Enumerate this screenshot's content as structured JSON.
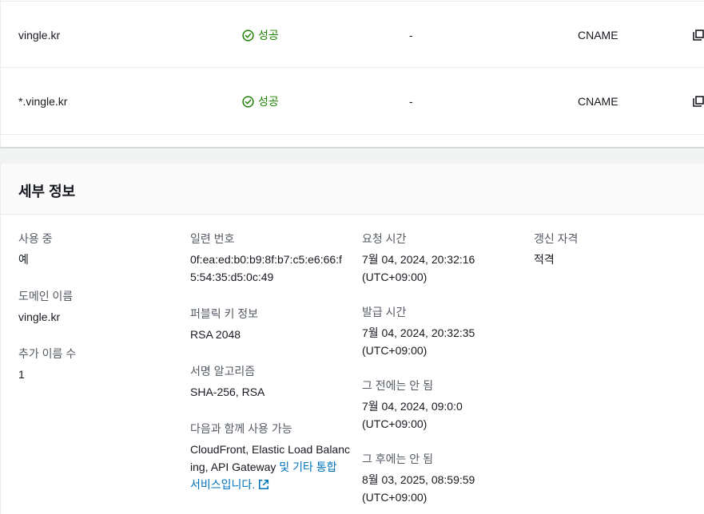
{
  "domains": [
    {
      "name": "vingle.kr",
      "status": "성공",
      "dash": "-",
      "type": "CNAME"
    },
    {
      "name": "*.vingle.kr",
      "status": "성공",
      "dash": "-",
      "type": "CNAME"
    }
  ],
  "details": {
    "title": "세부 정보",
    "in_use": {
      "label": "사용 중",
      "value": "예"
    },
    "domain_name": {
      "label": "도메인 이름",
      "value": "vingle.kr"
    },
    "additional_names": {
      "label": "추가 이름 수",
      "value": "1"
    },
    "serial": {
      "label": "일련 번호",
      "value": "0f:ea:ed:b0:b9:8f:b7:c5:e6:66:f5:54:35:d5:0c:49"
    },
    "public_key": {
      "label": "퍼블릭 키 정보",
      "value": "RSA 2048"
    },
    "signature": {
      "label": "서명 알고리즘",
      "value": "SHA-256, RSA"
    },
    "usable_with": {
      "label": "다음과 함께 사용 가능",
      "value": "CloudFront, Elastic Load Balancing, API Gateway",
      "link": "및 기타 통합 서비스입니다."
    },
    "requested_at": {
      "label": "요청 시간",
      "value": "7월 04, 2024, 20:32:16",
      "tz": "(UTC+09:00)"
    },
    "issued_at": {
      "label": "발급 시간",
      "value": "7월 04, 2024, 20:32:35",
      "tz": "(UTC+09:00)"
    },
    "not_before": {
      "label": "그 전에는 안 됨",
      "value": "7월 04, 2024, 09:0:0",
      "tz": "(UTC+09:00)"
    },
    "not_after": {
      "label": "그 후에는 안 됨",
      "value": "8월 03, 2025, 08:59:59",
      "tz": "(UTC+09:00)"
    },
    "renewal": {
      "label": "갱신 자격",
      "value": "적격"
    }
  },
  "colors": {
    "success": "#1d8102",
    "link": "#0073bb",
    "label": "#545b64"
  },
  "icons": {
    "status": "status-success-icon",
    "copy": "copy-icon",
    "external": "external-link-icon"
  }
}
